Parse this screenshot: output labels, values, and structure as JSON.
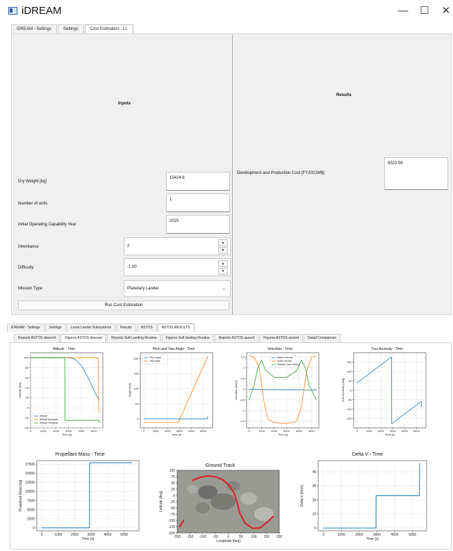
{
  "window": {
    "title": "iDREAM",
    "minimize_glyph": "—",
    "maximize_glyph": "☐",
    "close_glyph": "✕"
  },
  "top_tabs": [
    "iDREAM - Settings",
    "Settings",
    "Cost Estimation - LL"
  ],
  "inputs": {
    "title": "Inputs",
    "dry_weight_label": "Dry Weight [kg]",
    "dry_weight_value": "15424.6",
    "units_label": "Number of units",
    "units_value": "1",
    "ioc_label": "Initial Operating Capability Year",
    "ioc_value": "2025",
    "inheritance_label": "Inheritance",
    "inheritance_value": "2",
    "difficulty_label": "Difficulty",
    "difficulty_value": "-1,00",
    "mission_label": "Mission Type",
    "mission_value": "Planetary Lander",
    "run_button": "Run Cost Estimation"
  },
  "results": {
    "title": "Results",
    "cost_label": "Development and Production Cost [FY2021M$]",
    "cost_value": "8323.56"
  },
  "bottom_tabs": [
    "iDREAM - Settings",
    "Settings",
    "Lunar Lander Subsystems",
    "Results",
    "ASTOS",
    "ASTOS RESULTS"
  ],
  "sub_tabs": [
    "Reports ASTOS descent",
    "Figures ASTOS descent",
    "Reports Soft Landing Routine",
    "Figures Soft landing Routine",
    "Reports ASTOS ascent",
    "Figures ASTOS ascent",
    "Detail Comparison"
  ],
  "colors": {
    "blue": "#1f77b4",
    "orange": "#ff7f0e",
    "green": "#2ca02c",
    "red": "#d62728"
  },
  "chart_data": [
    {
      "id": "altitude",
      "type": "line",
      "title": "Altitude - Time",
      "xlabel": "Time [s]",
      "ylabel": "Altitude [km]",
      "xlim": [
        0,
        5700
      ],
      "ylim": [
        -40,
        110
      ],
      "xticks": [
        0,
        1000,
        2000,
        3000,
        4000,
        5000
      ],
      "yticks": [
        -40,
        -20,
        0,
        20,
        40,
        60,
        80,
        100
      ],
      "legend": "lower-left",
      "series": [
        {
          "name": "Altitude",
          "color": "blue",
          "x": [
            0,
            3000,
            3500,
            4000,
            4500,
            5000,
            5400
          ],
          "y": [
            100,
            100,
            97,
            85,
            62,
            35,
            15
          ]
        },
        {
          "name": "Altitude Apoapsis",
          "color": "orange",
          "x": [
            0,
            5350,
            5360,
            5400
          ],
          "y": [
            100,
            100,
            0,
            -10
          ]
        },
        {
          "name": "Altitude Periapsis",
          "color": "green",
          "x": [
            0,
            2700,
            2710,
            5400,
            5410
          ],
          "y": [
            100,
            100,
            -25,
            -25,
            -30
          ]
        }
      ]
    },
    {
      "id": "pitch",
      "type": "line",
      "title": "Pitch and Yaw Angle - Time",
      "xlabel": "Time [s]",
      "ylabel": "Angle [rad]",
      "xlim": [
        -300,
        5800
      ],
      "ylim": [
        -30,
        220
      ],
      "xticks": [
        0,
        1000,
        2000,
        3000,
        4000,
        5000
      ],
      "yticks": [
        0,
        50,
        100,
        150,
        200
      ],
      "legend": "top-left",
      "series": [
        {
          "name": "Pitch angle",
          "color": "blue",
          "x": [
            0,
            5350,
            5360,
            5400
          ],
          "y": [
            0,
            0,
            5,
            8
          ]
        },
        {
          "name": "Yaw angle",
          "color": "orange",
          "x": [
            0,
            2900,
            5400
          ],
          "y": [
            -12,
            -12,
            208
          ]
        }
      ]
    },
    {
      "id": "velocities",
      "type": "line",
      "title": "Velocities - Time",
      "xlabel": "Time [s]",
      "ylabel": "Velocities [km/s]",
      "xlim": [
        -200,
        5600
      ],
      "ylim": [
        -1.8,
        1.7
      ],
      "xticks": [
        0,
        1000,
        2000,
        3000,
        4000,
        5000
      ],
      "yticks": [
        -1.5,
        -1.0,
        -0.5,
        0.0,
        0.5,
        1.0,
        1.5
      ],
      "legend": "top-center",
      "series": [
        {
          "name": "Radial Velocity",
          "color": "blue",
          "x": [
            0,
            1000,
            2000,
            3000,
            4000,
            5000,
            5400
          ],
          "y": [
            0.0,
            -0.02,
            -0.02,
            -0.03,
            -0.03,
            -0.05,
            -0.02
          ]
        },
        {
          "name": "North Velocity",
          "color": "orange",
          "x": [
            0,
            400,
            800,
            1200,
            1500,
            2000,
            3000,
            3800,
            4200,
            4600,
            5000,
            5400
          ],
          "y": [
            1.55,
            1.5,
            1.0,
            -0.6,
            -1.4,
            -1.55,
            -1.6,
            -1.5,
            -0.8,
            0.8,
            1.5,
            1.55
          ]
        },
        {
          "name": "Relative East Velocity",
          "color": "green",
          "x": [
            0,
            400,
            700,
            1000,
            1300,
            2000,
            3000,
            3800,
            4200,
            4500,
            4800,
            5400
          ],
          "y": [
            -0.5,
            0.2,
            1.0,
            1.35,
            0.9,
            0.55,
            0.55,
            0.85,
            1.35,
            1.0,
            0.2,
            -0.5
          ]
        }
      ]
    },
    {
      "id": "anomaly",
      "type": "line",
      "title": "True Anomaly - Time",
      "xlabel": "Time [s]",
      "ylabel": "True Anomaly [deg]",
      "xlim": [
        -300,
        5800
      ],
      "ylim": [
        -200,
        200
      ],
      "xticks": [
        0,
        1000,
        2000,
        3000,
        4000,
        5000
      ],
      "yticks": [
        -150,
        -100,
        -50,
        0,
        50,
        100,
        150
      ],
      "series": [
        {
          "name": "",
          "color": "blue",
          "x": [
            0,
            2900,
            2910,
            5400,
            5410,
            5420
          ],
          "y": [
            40,
            178,
            -178,
            -60,
            -60,
            -90
          ]
        }
      ]
    },
    {
      "id": "propellant",
      "type": "line",
      "title": "Propellant Mass - Time",
      "xlabel": "Time [s]",
      "ylabel": "Propellant Mass [kg]",
      "xlim": [
        -300,
        5900
      ],
      "ylim": [
        -800,
        18500
      ],
      "xticks": [
        0,
        1000,
        2000,
        3000,
        4000,
        5000
      ],
      "yticks": [
        0,
        2500,
        5000,
        7500,
        10000,
        12500,
        15000,
        17500
      ],
      "series": [
        {
          "name": "",
          "color": "blue",
          "x": [
            0,
            2900,
            2905,
            5450
          ],
          "y": [
            0,
            0,
            17900,
            17900
          ]
        }
      ]
    },
    {
      "id": "groundtrack",
      "type": "scatter",
      "title": "Ground Track",
      "xlabel": "Longitude [deg]",
      "ylabel": "Latitude [deg]",
      "xlim": [
        -200,
        200
      ],
      "ylim": [
        -150,
        100
      ],
      "xticks": [
        -200,
        -150,
        -100,
        -50,
        0,
        50,
        100,
        150,
        200
      ],
      "yticks": [
        -150,
        -125,
        -100,
        -75,
        -50,
        -25,
        0,
        25,
        50,
        75,
        100
      ],
      "series": [
        {
          "name": "",
          "color": "red",
          "x": [
            -140,
            -110,
            -80,
            -50,
            -20,
            5,
            25,
            35,
            45,
            65,
            95,
            125,
            155,
            175
          ],
          "y": [
            60,
            72,
            78,
            74,
            62,
            38,
            5,
            -30,
            -70,
            -110,
            -132,
            -130,
            -105,
            -85
          ]
        },
        {
          "name": "",
          "color": "red",
          "x": [
            -190,
            -175
          ],
          "y": [
            -125,
            -100
          ]
        }
      ]
    },
    {
      "id": "deltav",
      "type": "line",
      "title": "Delta V - Time",
      "xlabel": "Time [s]",
      "ylabel": "Delta V [km/s]",
      "xlim": [
        -300,
        5800
      ],
      "ylim": [
        -2,
        48
      ],
      "xticks": [
        0,
        1000,
        2000,
        3000,
        4000,
        5000
      ],
      "yticks": [
        0,
        10,
        20,
        30,
        40
      ],
      "series": [
        {
          "name": "",
          "color": "blue",
          "x": [
            0,
            2950,
            2955,
            5400,
            5405
          ],
          "y": [
            0,
            0,
            23,
            23,
            46
          ]
        }
      ]
    }
  ]
}
